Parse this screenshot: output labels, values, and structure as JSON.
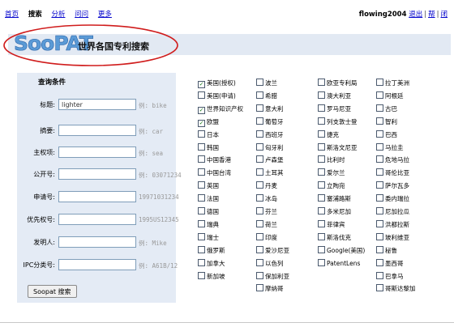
{
  "nav": {
    "items": [
      {
        "label": "首页",
        "current": false
      },
      {
        "label": "搜索",
        "current": true
      },
      {
        "label": "分析",
        "current": false
      },
      {
        "label": "问问",
        "current": false
      },
      {
        "label": "更多",
        "current": false
      }
    ]
  },
  "user": {
    "name": "flowing2004",
    "logout": "退出",
    "help": "帮",
    "close": "闭",
    "separator": "|"
  },
  "logo": {
    "text": "SooPAT",
    "tagline": "世界各国专利搜索",
    "logo_color": "#5a9ad6",
    "ellipse_color": "#d01c1c"
  },
  "form": {
    "title": "查询条件",
    "fields": [
      {
        "label": "标题:",
        "value": "lighter",
        "hint": "例: bike"
      },
      {
        "label": "摘要:",
        "value": "",
        "hint": "例: car"
      },
      {
        "label": "主权项:",
        "value": "",
        "hint": "例: sea"
      },
      {
        "label": "公开号:",
        "value": "",
        "hint": "例: 03071234"
      },
      {
        "label": "申请号:",
        "value": "",
        "hint": "19971031234"
      },
      {
        "label": "优先权号:",
        "value": "",
        "hint": "1995US12345"
      },
      {
        "label": "发明人:",
        "value": "",
        "hint": "例: Mike"
      },
      {
        "label": "IPC分类号:",
        "value": "",
        "hint": "例: A61B/12"
      }
    ],
    "button": "Soopat 搜索"
  },
  "countries": {
    "columns": [
      [
        {
          "label": "美国(授权)",
          "checked": true
        },
        {
          "label": "美国(申请)",
          "checked": false
        },
        {
          "label": "世界知识产权",
          "checked": true
        },
        {
          "label": "欧盟",
          "checked": true
        },
        {
          "label": "日本",
          "checked": false
        },
        {
          "label": "韩国",
          "checked": false
        },
        {
          "label": "中国香港",
          "checked": false
        },
        {
          "label": "中国台湾",
          "checked": false
        },
        {
          "label": "英国",
          "checked": false
        },
        {
          "label": "法国",
          "checked": false
        },
        {
          "label": "德国",
          "checked": false
        },
        {
          "label": "瑞典",
          "checked": false
        },
        {
          "label": "瑞士",
          "checked": false
        },
        {
          "label": "俄罗斯",
          "checked": false
        },
        {
          "label": "加拿大",
          "checked": false
        },
        {
          "label": "新加坡",
          "checked": false
        }
      ],
      [
        {
          "label": "波兰",
          "checked": false
        },
        {
          "label": "希腊",
          "checked": false
        },
        {
          "label": "意大利",
          "checked": false
        },
        {
          "label": "葡萄牙",
          "checked": false
        },
        {
          "label": "西班牙",
          "checked": false
        },
        {
          "label": "匈牙利",
          "checked": false
        },
        {
          "label": "卢森堡",
          "checked": false
        },
        {
          "label": "土耳其",
          "checked": false
        },
        {
          "label": "丹麦",
          "checked": false
        },
        {
          "label": "冰岛",
          "checked": false
        },
        {
          "label": "芬兰",
          "checked": false
        },
        {
          "label": "荷兰",
          "checked": false
        },
        {
          "label": "印度",
          "checked": false
        },
        {
          "label": "爱沙尼亚",
          "checked": false
        },
        {
          "label": "以色列",
          "checked": false
        },
        {
          "label": "保加利亚",
          "checked": false
        },
        {
          "label": "摩纳哥",
          "checked": false
        }
      ],
      [
        {
          "label": "欧亚专利局",
          "checked": false
        },
        {
          "label": "澳大利亚",
          "checked": false
        },
        {
          "label": "罗马尼亚",
          "checked": false
        },
        {
          "label": "列支敦士登",
          "checked": false
        },
        {
          "label": "捷克",
          "checked": false
        },
        {
          "label": "斯洛文尼亚",
          "checked": false
        },
        {
          "label": "比利时",
          "checked": false
        },
        {
          "label": "爱尔兰",
          "checked": false
        },
        {
          "label": "立陶宛",
          "checked": false
        },
        {
          "label": "塞浦路斯",
          "checked": false
        },
        {
          "label": "多米尼加",
          "checked": false
        },
        {
          "label": "菲律宾",
          "checked": false
        },
        {
          "label": "斯洛伐克",
          "checked": false
        },
        {
          "label": "Google(美国)",
          "checked": false
        },
        {
          "label": "PatentLens",
          "checked": false
        }
      ],
      [
        {
          "label": "拉丁美洲",
          "checked": false
        },
        {
          "label": "阿根廷",
          "checked": false
        },
        {
          "label": "古巴",
          "checked": false
        },
        {
          "label": "智利",
          "checked": false
        },
        {
          "label": "巴西",
          "checked": false
        },
        {
          "label": "马拉圭",
          "checked": false
        },
        {
          "label": "危地马拉",
          "checked": false
        },
        {
          "label": "哥伦比亚",
          "checked": false
        },
        {
          "label": "萨尔瓦多",
          "checked": false
        },
        {
          "label": "委内瑞拉",
          "checked": false
        },
        {
          "label": "尼加拉瓜",
          "checked": false
        },
        {
          "label": "洪都拉斯",
          "checked": false
        },
        {
          "label": "玻利维亚",
          "checked": false
        },
        {
          "label": "秘鲁",
          "checked": false
        },
        {
          "label": "墨西哥",
          "checked": false
        },
        {
          "label": "巴拿马",
          "checked": false
        },
        {
          "label": "哥斯达黎加",
          "checked": false
        }
      ]
    ]
  },
  "colors": {
    "panel_bg": "#e4ebf5",
    "strip_bg": "#e2e9f3",
    "link": "#0000cc",
    "check": "#1a7a1a"
  },
  "icons": {
    "checked": "checkmark-icon"
  }
}
